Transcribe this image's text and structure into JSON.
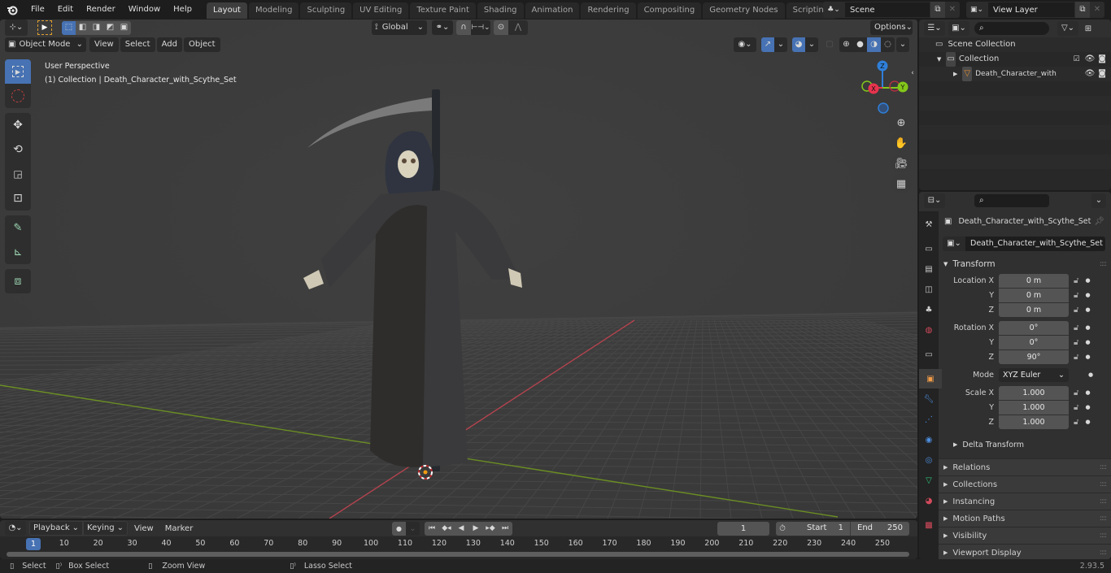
{
  "app": {
    "menu": [
      "File",
      "Edit",
      "Render",
      "Window",
      "Help"
    ],
    "workspaces": [
      "Layout",
      "Modeling",
      "Sculpting",
      "UV Editing",
      "Texture Paint",
      "Shading",
      "Animation",
      "Rendering",
      "Compositing",
      "Geometry Nodes",
      "Scripting"
    ],
    "active_workspace": "Layout",
    "add_workspace_icon": "+",
    "scene": "Scene",
    "view_layer": "View Layer"
  },
  "viewport": {
    "mode": "Object Mode",
    "menus": [
      "View",
      "Select",
      "Add",
      "Object"
    ],
    "orientation": "Global",
    "options_label": "Options",
    "overlay_title": "User Perspective",
    "overlay_subtitle": "(1) Collection | Death_Character_with_Scythe_Set",
    "tools": [
      "select-box",
      "cursor",
      "move",
      "rotate",
      "scale",
      "transform",
      "annotate",
      "measure",
      "add-cube"
    ],
    "gizmo": {
      "x": "X",
      "y": "Y",
      "z": "Z",
      "x_color": "#e8344e",
      "y_color": "#83c71a",
      "z_color": "#2f7fd9"
    },
    "shading_active": "solid-material"
  },
  "outliner": {
    "search_placeholder": "",
    "rows": [
      {
        "label": "Scene Collection",
        "level": 0,
        "icon": "scene-collection-icon"
      },
      {
        "label": "Collection",
        "level": 1,
        "icon": "collection-icon",
        "expanded": true,
        "checked": true
      },
      {
        "label": "Death_Character_with_Sc",
        "level": 2,
        "icon": "mesh-object-icon",
        "expanded": false
      }
    ]
  },
  "properties": {
    "object_name": "Death_Character_with_Scythe_Set",
    "datablock_name": "Death_Character_with_Scythe_Set",
    "transform_label": "Transform",
    "location": {
      "label": "Location X",
      "x": "0 m",
      "y": "0 m",
      "z": "0 m"
    },
    "rotation": {
      "label": "Rotation X",
      "x": "0°",
      "y": "0°",
      "z": "90°"
    },
    "mode_label": "Mode",
    "mode_value": "XYZ Euler",
    "scale": {
      "label": "Scale X",
      "x": "1.000",
      "y": "1.000",
      "z": "1.000"
    },
    "axis_y": "Y",
    "axis_z": "Z",
    "delta_transform": "Delta Transform",
    "panels": [
      "Relations",
      "Collections",
      "Instancing",
      "Motion Paths",
      "Visibility",
      "Viewport Display"
    ],
    "tabs": [
      "tool",
      "render",
      "output",
      "view-layer",
      "scene",
      "world",
      "collection",
      "object",
      "modifiers",
      "particles",
      "physics",
      "constraints",
      "data",
      "material",
      "texture"
    ],
    "active_tab": "object"
  },
  "timeline": {
    "menus": [
      "Playback",
      "Keying",
      "View",
      "Marker"
    ],
    "current_frame": "1",
    "start_label": "Start",
    "start": "1",
    "end_label": "End",
    "end": "250",
    "ticks": [
      "10",
      "20",
      "30",
      "40",
      "50",
      "60",
      "70",
      "80",
      "90",
      "100",
      "110",
      "120",
      "130",
      "140",
      "150",
      "160",
      "170",
      "180",
      "190",
      "200",
      "210",
      "220",
      "230",
      "240",
      "250"
    ],
    "playhead": "1"
  },
  "statusbar": {
    "select": "Select",
    "box_select": "Box Select",
    "zoom_view": "Zoom View",
    "lasso_select": "Lasso Select",
    "version": "2.93.5"
  }
}
